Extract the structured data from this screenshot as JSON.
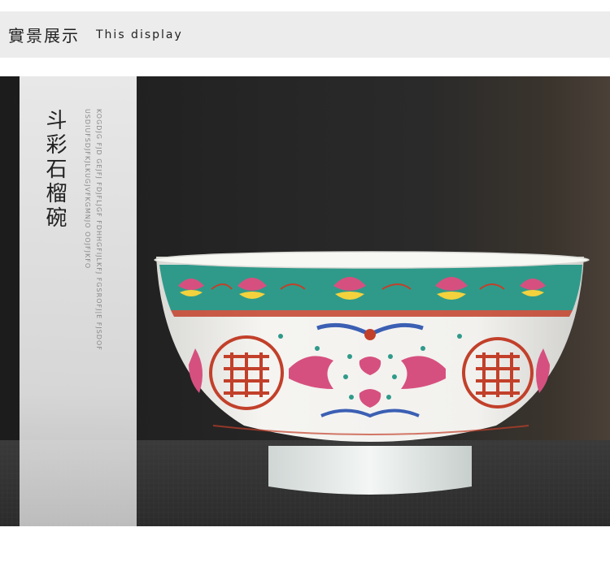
{
  "header": {
    "title_cn": "實景展示",
    "title_en": "This display"
  },
  "product": {
    "name": "斗彩石榴碗",
    "code_text": "KOGDJG FJD GEJFJ FDJFLJGF FDHHGFIJLKFJ FGSROFJ|E FJSDOFUSDIUFSDJFKJLKUGJVFKGMNJO OOJFJKFO"
  },
  "bowl": {
    "glyph_label": "壽",
    "colors": {
      "band": "#2f9a8a",
      "pink": "#d6507f",
      "yellow": "#f3d23d",
      "red": "#c2402a",
      "blue": "#3b5fb3",
      "body": "#f4f2ee"
    }
  }
}
